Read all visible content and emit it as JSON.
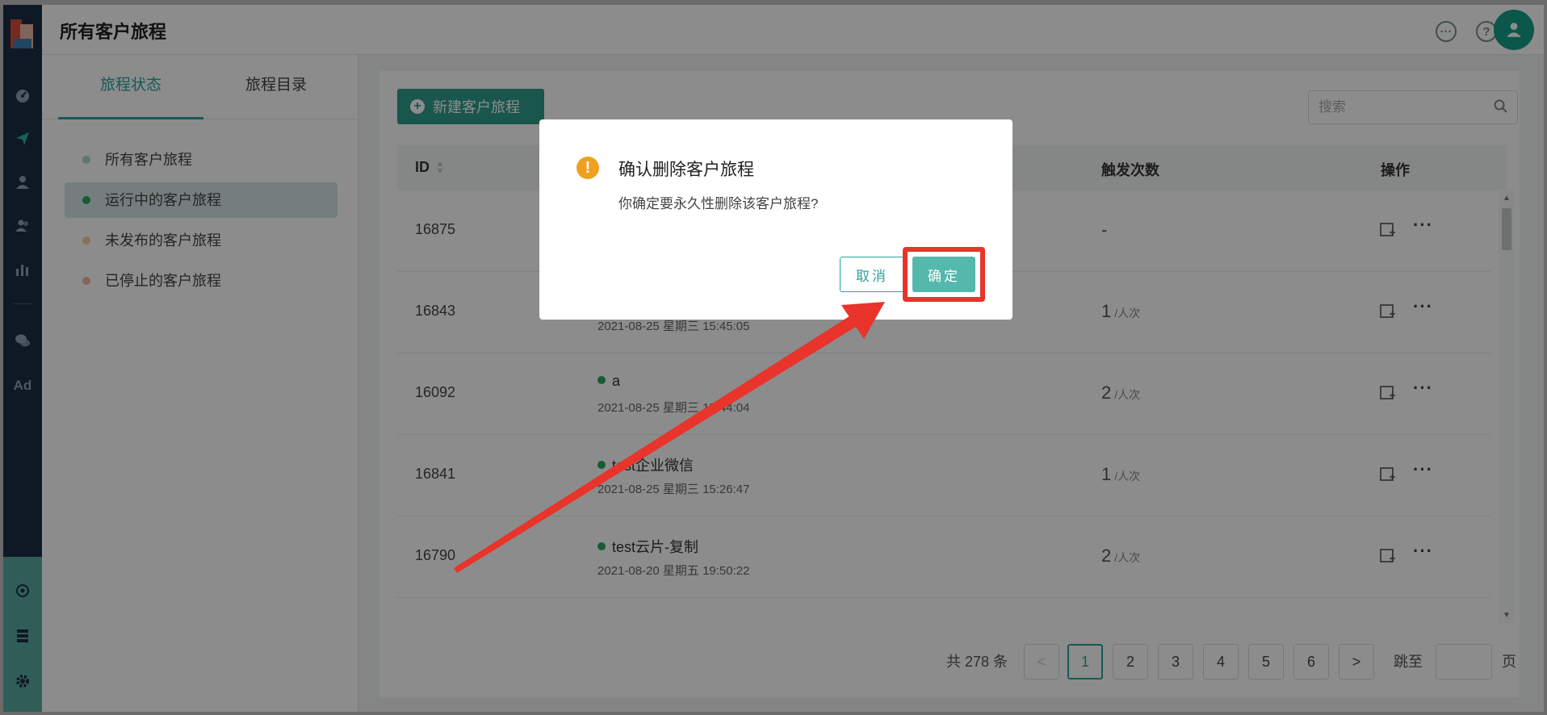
{
  "header": {
    "title": "所有客户旅程"
  },
  "sidebar": {
    "ad_label": "Ad"
  },
  "left_panel": {
    "tabs": [
      {
        "label": "旅程状态",
        "active": true
      },
      {
        "label": "旅程目录",
        "active": false
      }
    ],
    "items": [
      {
        "label": "所有客户旅程",
        "dot_color": "#a9d8d2"
      },
      {
        "label": "运行中的客户旅程",
        "dot_color": "#2aa561",
        "active": true
      },
      {
        "label": "未发布的客户旅程",
        "dot_color": "#f3d19c"
      },
      {
        "label": "已停止的客户旅程",
        "dot_color": "#f1b9a7"
      }
    ]
  },
  "toolbar": {
    "new_button_label": "新建客户旅程",
    "search_placeholder": "搜索"
  },
  "table": {
    "columns": {
      "id": "ID",
      "trigger_count": "触发次数",
      "actions": "操作"
    },
    "rows": [
      {
        "id": "16875",
        "name": "",
        "date": "",
        "count": "-",
        "unit": ""
      },
      {
        "id": "16843",
        "name": "",
        "date": "2021-08-25 星期三 15:45:05",
        "count": "1",
        "unit": "/人次"
      },
      {
        "id": "16092",
        "name": "a",
        "date": "2021-08-25 星期三 15:44:04",
        "count": "2",
        "unit": "/人次"
      },
      {
        "id": "16841",
        "name": "test企业微信",
        "date": "2021-08-25 星期三 15:26:47",
        "count": "1",
        "unit": "/人次"
      },
      {
        "id": "16790",
        "name": "test云片-复制",
        "date": "2021-08-20 星期五 19:50:22",
        "count": "2",
        "unit": "/人次"
      }
    ],
    "more_label": "···"
  },
  "pagination": {
    "total_label": "共 278 条",
    "prev": "<",
    "next": ">",
    "pages": [
      "1",
      "2",
      "3",
      "4",
      "5",
      "6"
    ],
    "current": "1",
    "goto_label": "跳至",
    "page_suffix": "页"
  },
  "modal": {
    "title": "确认删除客户旅程",
    "message": "你确定要永久性删除该客户旅程?",
    "cancel_label": "取消",
    "confirm_label": "确定"
  },
  "colors": {
    "primary": "#2f9d8a",
    "sidebar": "#1c2f44",
    "warning": "#f0a020",
    "highlight": "#e8342a"
  }
}
